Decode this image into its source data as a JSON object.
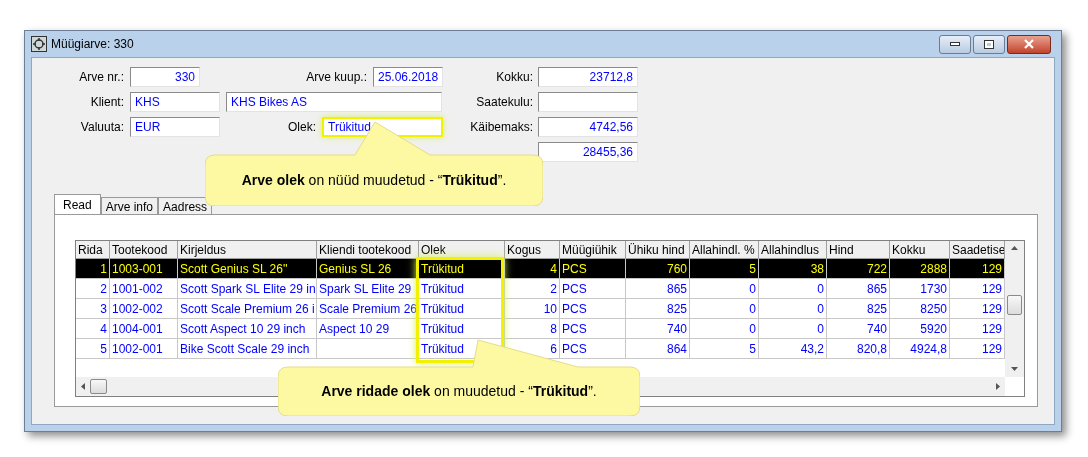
{
  "window": {
    "title": "Müügiarve: 330"
  },
  "form": {
    "arve_nr": {
      "label": "Arve nr.:",
      "value": "330"
    },
    "arve_kuup": {
      "label": "Arve kuup.:",
      "value": "25.06.2018"
    },
    "kokku": {
      "label": "Kokku:",
      "value": "23712,8"
    },
    "klient": {
      "label": "Klient:",
      "code": "KHS",
      "name": "KHS Bikes AS"
    },
    "saatekulu": {
      "label": "Saatekulu:"
    },
    "valuuta": {
      "label": "Valuuta:",
      "value": "EUR"
    },
    "olek": {
      "label": "Olek:",
      "value": "Trükitud",
      "highlighted": true
    },
    "kaibemaks": {
      "label": "Käibemaks:",
      "value": "4742,56"
    },
    "koik_kokku": {
      "value": "28455,36"
    }
  },
  "tabs": [
    {
      "label": "Read",
      "selected": true
    },
    {
      "label": "Arve info",
      "selected": false
    },
    {
      "label": "Aadress",
      "selected": false
    }
  ],
  "table": {
    "columns": [
      {
        "label": "Rida",
        "highlighted": false
      },
      {
        "label": "Tootekood",
        "highlighted": false
      },
      {
        "label": "Kirjeldus",
        "highlighted": false
      },
      {
        "label": "Kliendi tootekood",
        "highlighted": false
      },
      {
        "label": "Olek",
        "highlighted": true
      },
      {
        "label": "Kogus",
        "highlighted": false
      },
      {
        "label": "Müügiühik",
        "highlighted": false
      },
      {
        "label": "Ühiku hind",
        "highlighted": false
      },
      {
        "label": "Allahindl. %",
        "highlighted": false
      },
      {
        "label": "Allahindlus",
        "highlighted": false
      },
      {
        "label": "Hind",
        "highlighted": false
      },
      {
        "label": "Kokku",
        "highlighted": false
      },
      {
        "label": "Saadetise",
        "highlighted": false
      }
    ],
    "rows": [
      {
        "selected": true,
        "cells": [
          "1",
          "1003-001",
          "Scott Genius SL 26''",
          "Genius SL 26",
          "Trükitud",
          "4",
          "PCS",
          "760",
          "5",
          "38",
          "722",
          "2888",
          "129"
        ]
      },
      {
        "selected": false,
        "cells": [
          "2",
          "1001-002",
          "Scott Spark SL Elite 29 in",
          "Spark SL Elite 29",
          "Trükitud",
          "2",
          "PCS",
          "865",
          "0",
          "0",
          "865",
          "1730",
          "129"
        ]
      },
      {
        "selected": false,
        "cells": [
          "3",
          "1002-002",
          "Scott Scale Premium 26 i",
          "Scale Premium 26",
          "Trükitud",
          "10",
          "PCS",
          "825",
          "0",
          "0",
          "825",
          "8250",
          "129"
        ]
      },
      {
        "selected": false,
        "cells": [
          "4",
          "1004-001",
          "Scott Aspect 10 29 inch",
          "Aspect 10 29",
          "Trükitud",
          "8",
          "PCS",
          "740",
          "0",
          "0",
          "740",
          "5920",
          "129"
        ]
      },
      {
        "selected": false,
        "cells": [
          "5",
          "1002-001",
          "Bike Scott Scale 29 inch",
          "",
          "Trükitud",
          "6",
          "PCS",
          "864",
          "5",
          "43,2",
          "820,8",
          "4924,8",
          "129"
        ]
      }
    ]
  },
  "callouts": [
    {
      "text": "**Arve olek** on nüüd muudetud - “**Trükitud**”."
    },
    {
      "text": "**Arve ridade olek** on muudetud - “**Trükitud**”."
    }
  ]
}
